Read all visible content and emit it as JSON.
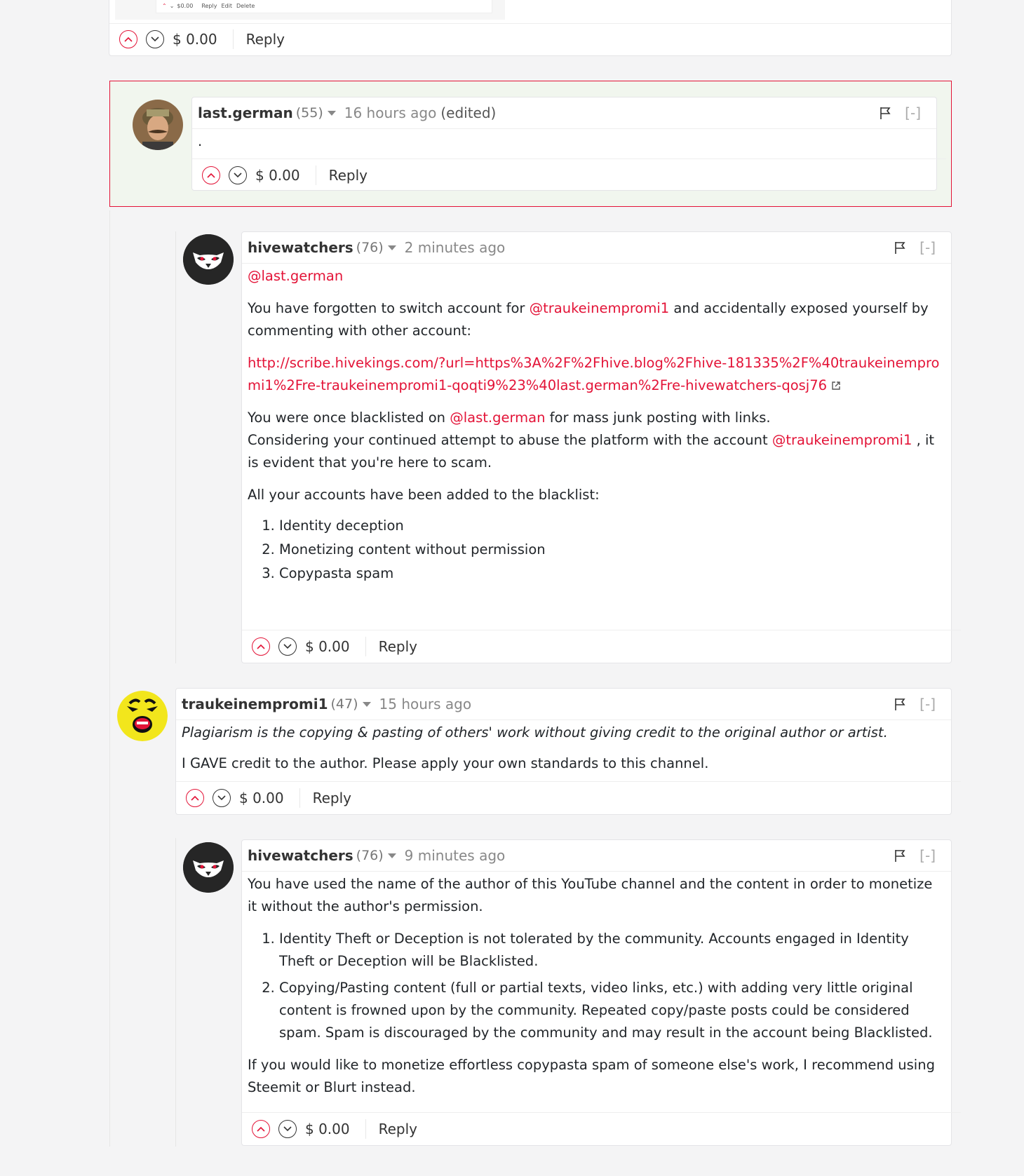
{
  "top": {
    "mini": {
      "payout": "$0.00",
      "reply": "Reply",
      "edit": "Edit",
      "delete": "Delete"
    },
    "footer": {
      "payout": "$ 0.00",
      "reply": "Reply"
    }
  },
  "comments": [
    {
      "author": "last.german",
      "rep": "(55)",
      "time": "16 hours ago",
      "edited": "(edited)",
      "body": ".",
      "payout": "$ 0.00",
      "reply": "Reply",
      "collapse": "[-]"
    },
    {
      "author": "hivewatchers",
      "rep": "(76)",
      "time": "2 minutes ago",
      "collapse": "[-]",
      "mention": "@last.german",
      "p1_pre": "You have forgotten to switch account for ",
      "p1_link": "@traukeinempromi1",
      "p1_post": " and accidentally exposed yourself by commenting with other account:",
      "url": "http://scribe.hivekings.com/?url=https%3A%2F%2Fhive.blog%2Fhive-181335%2F%40traukeinempromi1%2Fre-traukeinempromi1-qoqti9%23%40last.german%2Fre-hivewatchers-qosj76",
      "p3_pre": "You were once blacklisted on ",
      "p3_link": "@last.german",
      "p3_post": " for mass junk posting with links.",
      "p4_pre": "Considering your continued attempt to abuse the platform with the account ",
      "p4_link": "@traukeinempromi1",
      "p4_post": " , it is evident that you're here to scam.",
      "p5": "All your accounts have been added to the blacklist:",
      "list": [
        "Identity deception",
        "Monetizing content without permission",
        "Copypasta spam"
      ],
      "payout": "$ 0.00",
      "reply": "Reply"
    },
    {
      "author": "traukeinempromi1",
      "rep": "(47)",
      "time": "15 hours ago",
      "collapse": "[-]",
      "quote": "Plagiarism is the copying & pasting of others' work without giving credit to the original author or artist.",
      "p2": "I GAVE credit to the author. Please apply your own standards to this channel.",
      "payout": "$ 0.00",
      "reply": "Reply"
    },
    {
      "author": "hivewatchers",
      "rep": "(76)",
      "time": "9 minutes ago",
      "collapse": "[-]",
      "p1": "You have used the name of the author of this YouTube channel and the content in order to monetize it without the author's permission.",
      "list": [
        "Identity Theft or Deception is not tolerated by the community. Accounts engaged in Identity Theft or Deception will be Blacklisted.",
        "Copying/Pasting content (full or partial texts, video links, etc.) with adding very little original content is frowned upon by the community. Repeated copy/paste posts could be considered spam. Spam is discouraged by the community and may result in the account being Blacklisted."
      ],
      "p2": "If you would like to monetize effortless copypasta spam of someone else's work, I recommend using Steemit or Blurt instead.",
      "payout": "$ 0.00",
      "reply": "Reply"
    }
  ],
  "icons": {
    "upvote": "chevron-up-circle",
    "downvote": "chevron-down-circle",
    "flag": "flag",
    "external": "external-link"
  },
  "colors": {
    "accent": "#e31337",
    "highlight_bg": "#f1f6ee",
    "highlight_border": "#e31337"
  }
}
